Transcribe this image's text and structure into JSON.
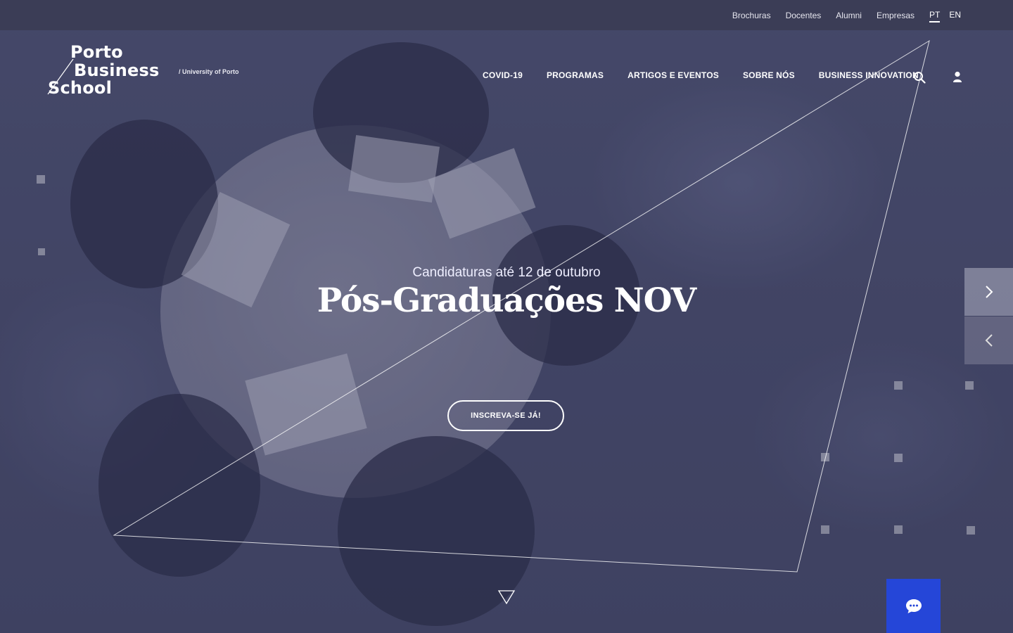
{
  "topbar": {
    "links": [
      "Brochuras",
      "Docentes",
      "Alumni",
      "Empresas"
    ],
    "languages": [
      {
        "label": "PT",
        "active": true
      },
      {
        "label": "EN",
        "active": false
      }
    ]
  },
  "logo": {
    "line1": "Porto",
    "line2": "Business",
    "line3": "School",
    "university": "/ University of Porto"
  },
  "nav": {
    "items": [
      "COVID-19",
      "PROGRAMAS",
      "ARTIGOS E EVENTOS",
      "SOBRE NÓS",
      "BUSINESS INNOVATION"
    ],
    "search_icon": "search-icon",
    "user_icon": "user-icon"
  },
  "hero": {
    "subtitle": "Candidaturas até 12 de outubro",
    "title": "Pós-Graduações NOV",
    "cta_label": "INSCREVA-SE JÁ!"
  },
  "slider": {
    "next_icon": "chevron-right-icon",
    "prev_icon": "chevron-left-icon"
  },
  "chat": {
    "icon": "chat-bubble-icon",
    "color": "#2546d8"
  }
}
